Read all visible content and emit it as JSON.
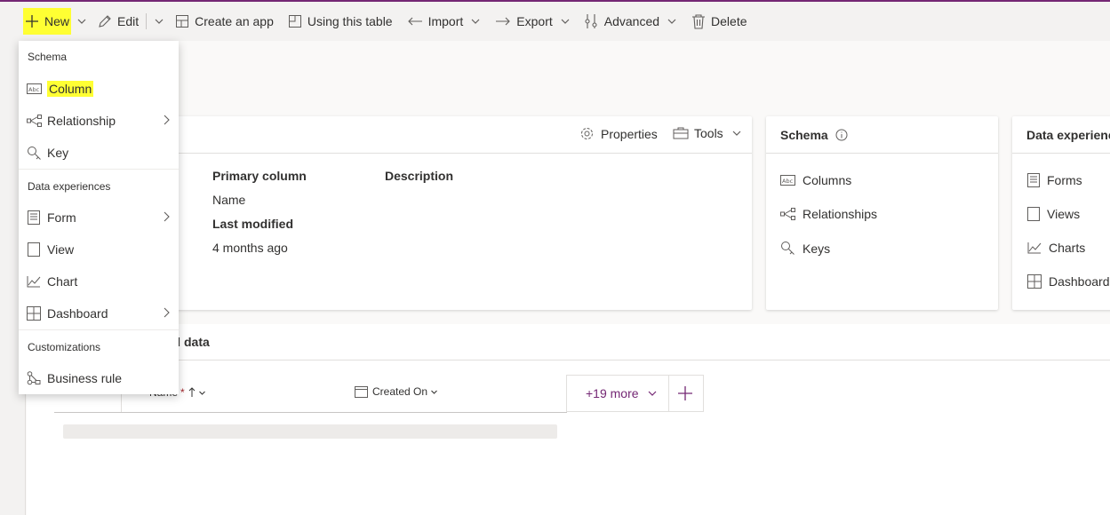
{
  "command_bar": {
    "new_label": "New",
    "edit_label": "Edit",
    "create_app_label": "Create an app",
    "using_table_label": "Using this table",
    "import_label": "Import",
    "export_label": "Export",
    "advanced_label": "Advanced",
    "delete_label": "Delete"
  },
  "new_menu": {
    "schema_header": "Schema",
    "column": "Column",
    "relationship": "Relationship",
    "key": "Key",
    "data_exp_header": "Data experiences",
    "form": "Form",
    "view": "View",
    "chart": "Chart",
    "dashboard": "Dashboard",
    "custom_header": "Customizations",
    "business_rule": "Business rule"
  },
  "properties_card": {
    "properties_label": "Properties",
    "tools_label": "Tools",
    "primary_column_label": "Primary column",
    "primary_column_value": "Name",
    "description_label": "Description",
    "last_modified_label": "Last modified",
    "last_modified_value": "4 months ago"
  },
  "schema_card": {
    "title": "Schema",
    "items": [
      "Columns",
      "Relationships",
      "Keys"
    ]
  },
  "data_exp_card": {
    "title": "Data experienc",
    "items": [
      "Forms",
      "Views",
      "Charts",
      "Dashboards"
    ]
  },
  "grid": {
    "section_title": "nd data",
    "col_name": "Name",
    "required_mark": "*",
    "col_created": "Created On",
    "more_label": "+19 more"
  },
  "colors": {
    "accent": "#742774",
    "highlight": "#ffff33",
    "required": "#a4262c"
  }
}
